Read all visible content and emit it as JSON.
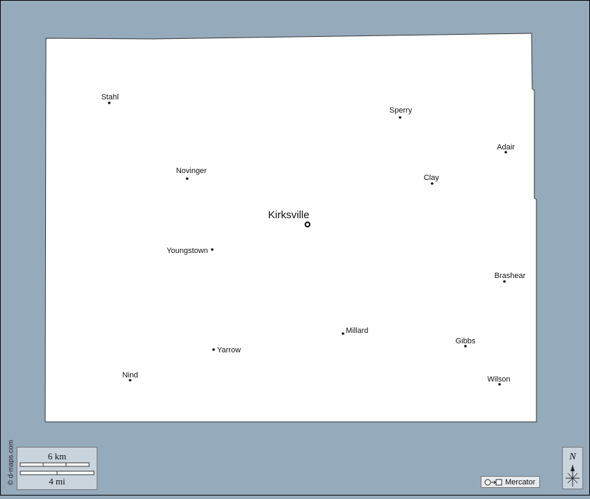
{
  "map": {
    "credit": "© d-maps.com",
    "county_fill": "#ffffff",
    "water_color": "#95aabb",
    "places": [
      {
        "name": "Stahl",
        "kind": "town"
      },
      {
        "name": "Sperry",
        "kind": "town"
      },
      {
        "name": "Adair",
        "kind": "town"
      },
      {
        "name": "Novinger",
        "kind": "town"
      },
      {
        "name": "Clay",
        "kind": "town"
      },
      {
        "name": "Kirksville",
        "kind": "county-seat"
      },
      {
        "name": "Youngstown",
        "kind": "town"
      },
      {
        "name": "Brashear",
        "kind": "town"
      },
      {
        "name": "Millard",
        "kind": "town"
      },
      {
        "name": "Gibbs",
        "kind": "town"
      },
      {
        "name": "Yarrow",
        "kind": "town"
      },
      {
        "name": "Nind",
        "kind": "town"
      },
      {
        "name": "Wilson",
        "kind": "town"
      }
    ],
    "scale": {
      "km_label": "6 km",
      "mi_label": "4 mi"
    },
    "projection": {
      "label": "Mercator",
      "icon": "circle-to-square-icon"
    },
    "compass": {
      "north_label": "N",
      "icon": "compass-rose-icon"
    }
  }
}
